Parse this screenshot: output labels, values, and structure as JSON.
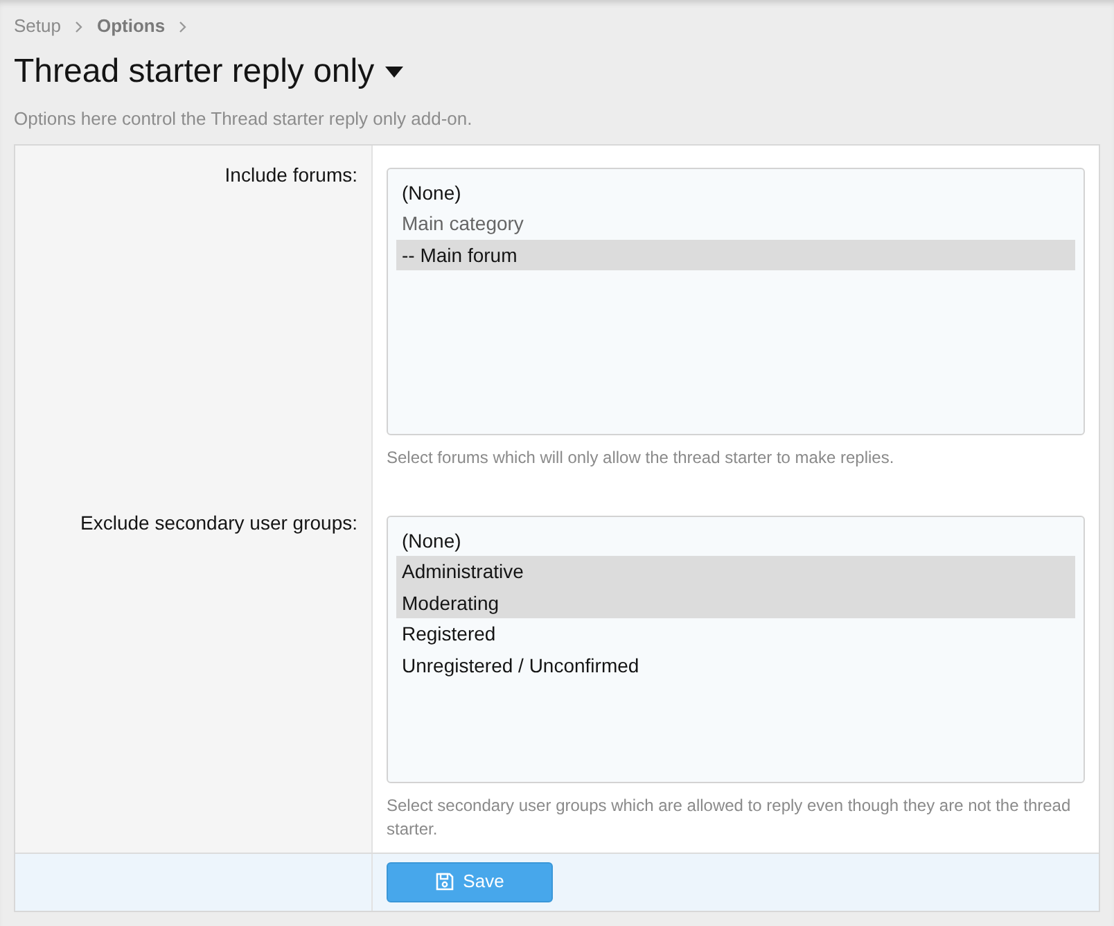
{
  "breadcrumb": [
    {
      "label": "Setup",
      "current": false
    },
    {
      "label": "Options",
      "current": true
    }
  ],
  "title": "Thread starter reply only",
  "description": "Options here control the Thread starter reply only add-on.",
  "fields": [
    {
      "label": "Include forums:",
      "options": [
        {
          "label": "(None)",
          "kind": "option",
          "selected": false
        },
        {
          "label": "Main category",
          "kind": "group",
          "selected": false
        },
        {
          "label": "-- Main forum",
          "kind": "option",
          "selected": true
        }
      ],
      "hint": "Select forums which will only allow the thread starter to make replies."
    },
    {
      "label": "Exclude secondary user groups:",
      "options": [
        {
          "label": "(None)",
          "kind": "option",
          "selected": false
        },
        {
          "label": "Administrative",
          "kind": "option",
          "selected": true
        },
        {
          "label": "Moderating",
          "kind": "option",
          "selected": true
        },
        {
          "label": "Registered",
          "kind": "option",
          "selected": false
        },
        {
          "label": "Unregistered / Unconfirmed",
          "kind": "option",
          "selected": false
        }
      ],
      "hint": "Select secondary user groups which are allowed to reply even though they are not the thread starter."
    }
  ],
  "save_button": {
    "label": "Save"
  }
}
